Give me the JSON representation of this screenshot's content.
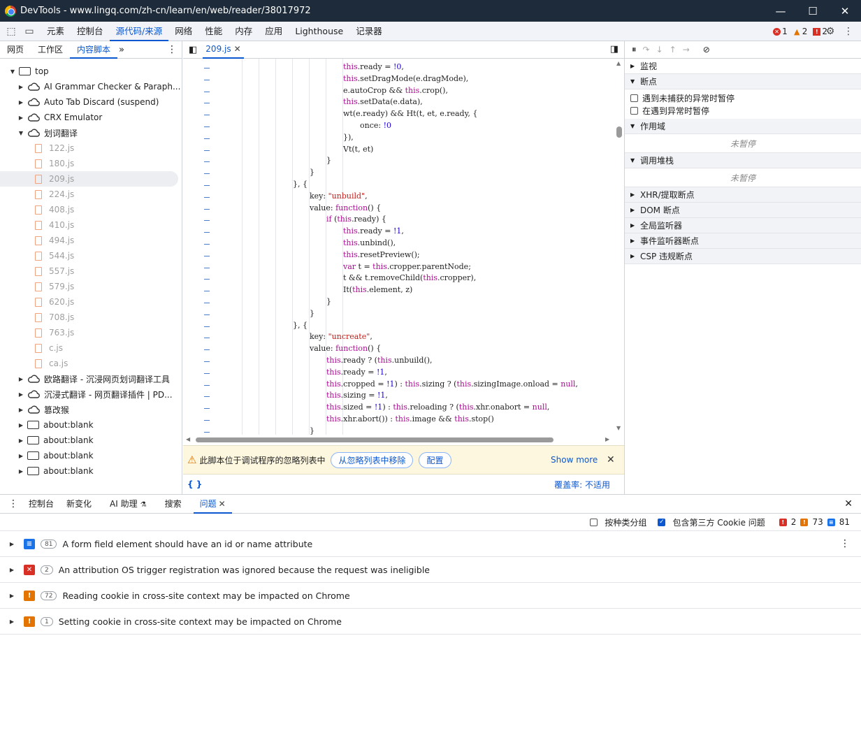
{
  "window": {
    "title": "DevTools - www.lingq.com/zh-cn/learn/en/web/reader/38017972"
  },
  "toolbar": {
    "tabs": [
      "元素",
      "控制台",
      "源代码/来源",
      "网络",
      "性能",
      "内存",
      "应用",
      "Lighthouse",
      "记录器"
    ],
    "errors": "1",
    "warnings": "2",
    "issues": "2"
  },
  "left": {
    "tabs": [
      "网页",
      "工作区",
      "内容脚本"
    ],
    "tree": [
      {
        "label": "top",
        "type": "frame",
        "level": 0,
        "open": true
      },
      {
        "label": "AI Grammar Checker & Paraph...",
        "type": "ext",
        "level": 1
      },
      {
        "label": "Auto Tab Discard (suspend)",
        "type": "ext",
        "level": 1
      },
      {
        "label": "CRX Emulator",
        "type": "ext",
        "level": 1
      },
      {
        "label": "划词翻译",
        "type": "ext",
        "level": 1,
        "open": true
      },
      {
        "label": "122.js",
        "type": "file",
        "level": 2
      },
      {
        "label": "180.js",
        "type": "file",
        "level": 2
      },
      {
        "label": "209.js",
        "type": "file",
        "level": 2,
        "selected": true
      },
      {
        "label": "224.js",
        "type": "file",
        "level": 2
      },
      {
        "label": "408.js",
        "type": "file",
        "level": 2
      },
      {
        "label": "410.js",
        "type": "file",
        "level": 2
      },
      {
        "label": "494.js",
        "type": "file",
        "level": 2
      },
      {
        "label": "544.js",
        "type": "file",
        "level": 2
      },
      {
        "label": "557.js",
        "type": "file",
        "level": 2
      },
      {
        "label": "579.js",
        "type": "file",
        "level": 2
      },
      {
        "label": "620.js",
        "type": "file",
        "level": 2
      },
      {
        "label": "708.js",
        "type": "file",
        "level": 2
      },
      {
        "label": "763.js",
        "type": "file",
        "level": 2
      },
      {
        "label": "c.js",
        "type": "file",
        "level": 2
      },
      {
        "label": "ca.js",
        "type": "file",
        "level": 2
      },
      {
        "label": "欧路翻译 - 沉浸网页划词翻译工具",
        "type": "ext",
        "level": 1
      },
      {
        "label": "沉浸式翻译 - 网页翻译插件 | PD...",
        "type": "ext",
        "level": 1
      },
      {
        "label": "篡改猴",
        "type": "ext",
        "level": 1
      },
      {
        "label": "about:blank",
        "type": "frame",
        "level": 1
      },
      {
        "label": "about:blank",
        "type": "frame",
        "level": 1
      },
      {
        "label": "about:blank",
        "type": "frame",
        "level": 1
      },
      {
        "label": "about:blank",
        "type": "frame",
        "level": 1
      }
    ]
  },
  "editor": {
    "tab": "209.js",
    "lines": [
      {
        "i": 230,
        "t": [
          [
            "kw",
            "this"
          ],
          [
            "",
            "."
          ],
          [
            "",
            "ready"
          ],
          [
            "",
            " = "
          ],
          [
            "num",
            "!0"
          ],
          [
            "",
            ","
          ]
        ]
      },
      {
        "i": 230,
        "t": [
          [
            "kw",
            "this"
          ],
          [
            "",
            ".setDragMode(e.dragMode),"
          ]
        ]
      },
      {
        "i": 230,
        "t": [
          [
            "",
            "e.autoCrop && "
          ],
          [
            "kw",
            "this"
          ],
          [
            "",
            ".crop(),"
          ]
        ]
      },
      {
        "i": 230,
        "t": [
          [
            "kw",
            "this"
          ],
          [
            "",
            ".setData(e.data),"
          ]
        ]
      },
      {
        "i": 230,
        "t": [
          [
            "",
            "wt(e.ready) && Ht(t, et, e.ready, {"
          ]
        ]
      },
      {
        "i": 254,
        "t": [
          [
            "",
            "once: "
          ],
          [
            "num",
            "!0"
          ]
        ]
      },
      {
        "i": 230,
        "t": [
          [
            "",
            "}),"
          ]
        ]
      },
      {
        "i": 230,
        "t": [
          [
            "",
            "Vt(t, et)"
          ]
        ]
      },
      {
        "i": 206,
        "t": [
          [
            "",
            "}"
          ]
        ]
      },
      {
        "i": 182,
        "t": [
          [
            "",
            "}"
          ]
        ]
      },
      {
        "i": 158,
        "t": [
          [
            "",
            "}, {"
          ]
        ]
      },
      {
        "i": 182,
        "t": [
          [
            "",
            "key: "
          ],
          [
            "str",
            "\"unbuild\""
          ],
          [
            "",
            ","
          ]
        ]
      },
      {
        "i": 182,
        "t": [
          [
            "",
            "value: "
          ],
          [
            "kw",
            "function"
          ],
          [
            "",
            "() {"
          ]
        ]
      },
      {
        "i": 206,
        "t": [
          [
            "kw",
            "if"
          ],
          [
            "",
            " ("
          ],
          [
            "kw",
            "this"
          ],
          [
            "",
            ".ready) {"
          ]
        ]
      },
      {
        "i": 230,
        "t": [
          [
            "kw",
            "this"
          ],
          [
            "",
            ".ready = "
          ],
          [
            "num",
            "!1"
          ],
          [
            "",
            ","
          ]
        ]
      },
      {
        "i": 230,
        "t": [
          [
            "kw",
            "this"
          ],
          [
            "",
            ".unbind(),"
          ]
        ]
      },
      {
        "i": 230,
        "t": [
          [
            "kw",
            "this"
          ],
          [
            "",
            ".resetPreview();"
          ]
        ]
      },
      {
        "i": 230,
        "t": [
          [
            "kw",
            "var"
          ],
          [
            "",
            " t = "
          ],
          [
            "kw",
            "this"
          ],
          [
            "",
            ".cropper.parentNode;"
          ]
        ]
      },
      {
        "i": 230,
        "t": [
          [
            "",
            "t && t.removeChild("
          ],
          [
            "kw",
            "this"
          ],
          [
            "",
            ".cropper),"
          ]
        ]
      },
      {
        "i": 230,
        "t": [
          [
            "",
            "It("
          ],
          [
            "kw",
            "this"
          ],
          [
            "",
            ".element, z)"
          ]
        ]
      },
      {
        "i": 206,
        "t": [
          [
            "",
            "}"
          ]
        ]
      },
      {
        "i": 182,
        "t": [
          [
            "",
            "}"
          ]
        ]
      },
      {
        "i": 158,
        "t": [
          [
            "",
            "}, {"
          ]
        ]
      },
      {
        "i": 182,
        "t": [
          [
            "",
            "key: "
          ],
          [
            "str",
            "\"uncreate\""
          ],
          [
            "",
            ","
          ]
        ]
      },
      {
        "i": 182,
        "t": [
          [
            "",
            "value: "
          ],
          [
            "kw",
            "function"
          ],
          [
            "",
            "() {"
          ]
        ]
      },
      {
        "i": 206,
        "t": [
          [
            "kw",
            "this"
          ],
          [
            "",
            ".ready ? ("
          ],
          [
            "kw",
            "this"
          ],
          [
            "",
            ".unbuild(),"
          ]
        ]
      },
      {
        "i": 206,
        "t": [
          [
            "kw",
            "this"
          ],
          [
            "",
            ".ready = "
          ],
          [
            "num",
            "!1"
          ],
          [
            "",
            ","
          ]
        ]
      },
      {
        "i": 206,
        "t": [
          [
            "kw",
            "this"
          ],
          [
            "",
            ".cropped = "
          ],
          [
            "num",
            "!1"
          ],
          [
            "",
            ") : "
          ],
          [
            "kw",
            "this"
          ],
          [
            "",
            ".sizing ? ("
          ],
          [
            "kw",
            "this"
          ],
          [
            "",
            ".sizingImage.onload = "
          ],
          [
            "kw",
            "null"
          ],
          [
            "",
            ","
          ]
        ]
      },
      {
        "i": 206,
        "t": [
          [
            "kw",
            "this"
          ],
          [
            "",
            ".sizing = "
          ],
          [
            "num",
            "!1"
          ],
          [
            "",
            ","
          ]
        ]
      },
      {
        "i": 206,
        "t": [
          [
            "kw",
            "this"
          ],
          [
            "",
            ".sized = "
          ],
          [
            "num",
            "!1"
          ],
          [
            "",
            ") : "
          ],
          [
            "kw",
            "this"
          ],
          [
            "",
            ".reloading ? ("
          ],
          [
            "kw",
            "this"
          ],
          [
            "",
            ".xhr.onabort = "
          ],
          [
            "kw",
            "null"
          ],
          [
            "",
            ","
          ]
        ]
      },
      {
        "i": 206,
        "t": [
          [
            "kw",
            "this"
          ],
          [
            "",
            ".xhr.abort()) : "
          ],
          [
            "kw",
            "this"
          ],
          [
            "",
            ".image && "
          ],
          [
            "kw",
            "this"
          ],
          [
            "",
            ".stop()"
          ]
        ]
      },
      {
        "i": 182,
        "t": [
          [
            "",
            "}"
          ]
        ]
      }
    ],
    "warning": "此脚本位于调试程序的忽略列表中",
    "remove_btn": "从忽略列表中移除",
    "config_btn": "配置",
    "show_more": "Show more",
    "format_icon": "curly-braces-icon",
    "coverage": "覆盖率: 不适用"
  },
  "right": {
    "sections": {
      "watch": "监视",
      "breakpoints": "断点",
      "chk1": "遇到未捕获的异常时暂停",
      "chk2": "在遇到异常时暂停",
      "scope": "作用域",
      "not_paused": "未暂停",
      "callstack": "调用堆栈",
      "xhr": "XHR/提取断点",
      "dom": "DOM 断点",
      "global": "全局监听器",
      "event": "事件监听器断点",
      "csp": "CSP 违规断点"
    }
  },
  "drawer": {
    "tabs": [
      "控制台",
      "新变化",
      "AI 助理",
      "搜索",
      "问题"
    ]
  },
  "issues": {
    "group_label": "按种类分组",
    "cookie_label": "包含第三方 Cookie 问题",
    "count_err": "2",
    "count_warn": "73",
    "count_info": "81",
    "items": [
      {
        "kind": "info",
        "count": "81",
        "text": "A form field element should have an id or name attribute"
      },
      {
        "kind": "error",
        "count": "2",
        "text": "An attribution OS trigger registration was ignored because the request was ineligible"
      },
      {
        "kind": "warn",
        "count": "72",
        "text": "Reading cookie in cross-site context may be impacted on Chrome"
      },
      {
        "kind": "warn",
        "count": "1",
        "text": "Setting cookie in cross-site context may be impacted on Chrome"
      }
    ]
  }
}
